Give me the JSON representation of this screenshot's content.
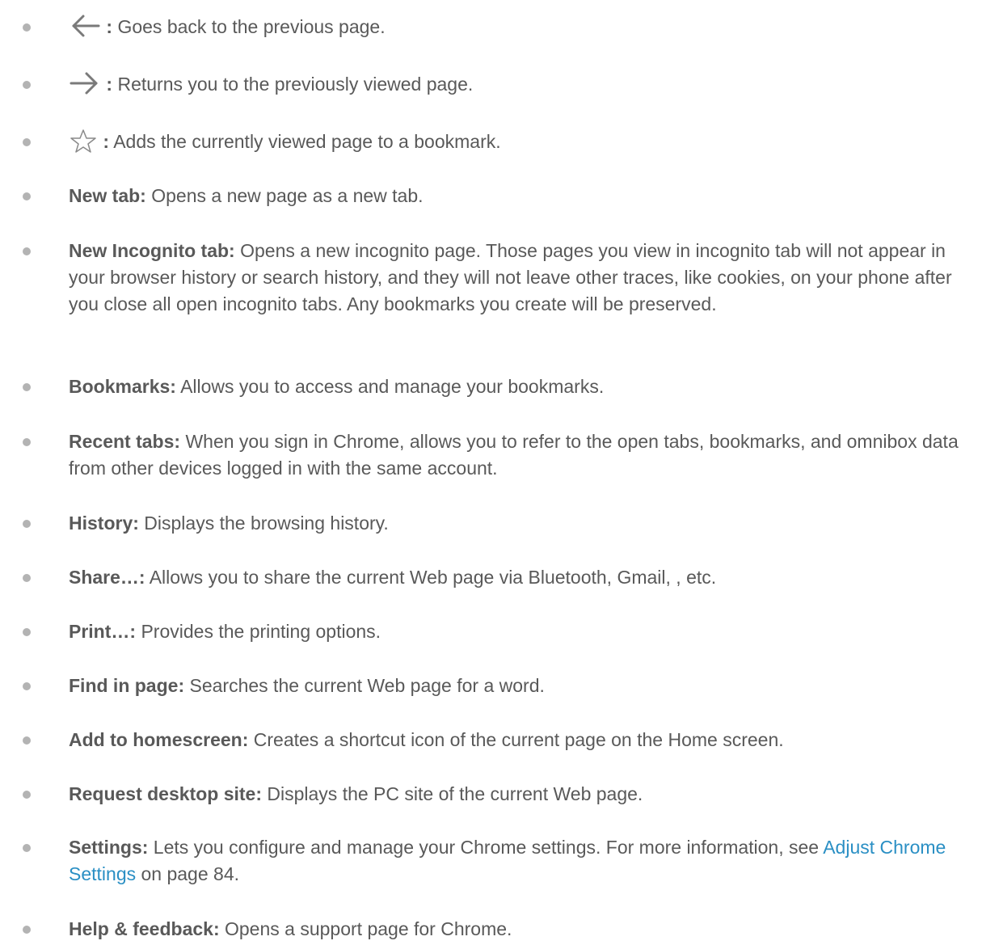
{
  "items": [
    {
      "icon": "back-arrow-icon",
      "term": ":",
      "desc": "Goes back to the previous page."
    },
    {
      "icon": "forward-arrow-icon",
      "term": ":",
      "desc": "Returns you to the previously viewed page."
    },
    {
      "icon": "star-outline-icon",
      "term": ":",
      "desc": "Adds the currently viewed page to a bookmark."
    },
    {
      "term": "New tab:",
      "desc": "Opens a new page as a new tab."
    },
    {
      "term": "New Incognito tab:",
      "desc": "Opens a new incognito page. Those pages you view in incognito tab will not appear in your browser history or search history, and they will not leave other traces, like cookies, on your phone after you close all open incognito tabs. Any bookmarks you create will be preserved."
    },
    {
      "term": "Bookmarks:",
      "desc": "Allows you to access and manage your bookmarks."
    },
    {
      "term": "Recent tabs:",
      "desc": "When you sign in Chrome, allows you to refer to the open tabs, bookmarks, and omnibox data from other devices logged in with the same account."
    },
    {
      "term": "History:",
      "desc": "Displays the browsing history."
    },
    {
      "term": "Share…:",
      "desc": "Allows you to share the current Web page via Bluetooth, Gmail, , etc."
    },
    {
      "term": "Print…:",
      "desc": "Provides the printing options."
    },
    {
      "term": "Find in page:",
      "desc": "Searches the current Web page for a word."
    },
    {
      "term": "Add to homescreen:",
      "desc": "Creates a shortcut icon of the current page on the Home screen."
    },
    {
      "term": "Request desktop site:",
      "desc": "Displays the PC site of the current Web page."
    },
    {
      "term": "Settings:",
      "desc": "Lets you configure and manage your Chrome settings. For more information, see",
      "link": "Adjust Chrome Settings",
      "desc_after": "on page 84."
    },
    {
      "term": "Help & feedback:",
      "desc": "Opens a support page for Chrome."
    }
  ],
  "colors": {
    "text": "#595959",
    "bullet": "#b3b3b3",
    "link": "#2a8fc4",
    "icon": "#7a7a7a"
  }
}
